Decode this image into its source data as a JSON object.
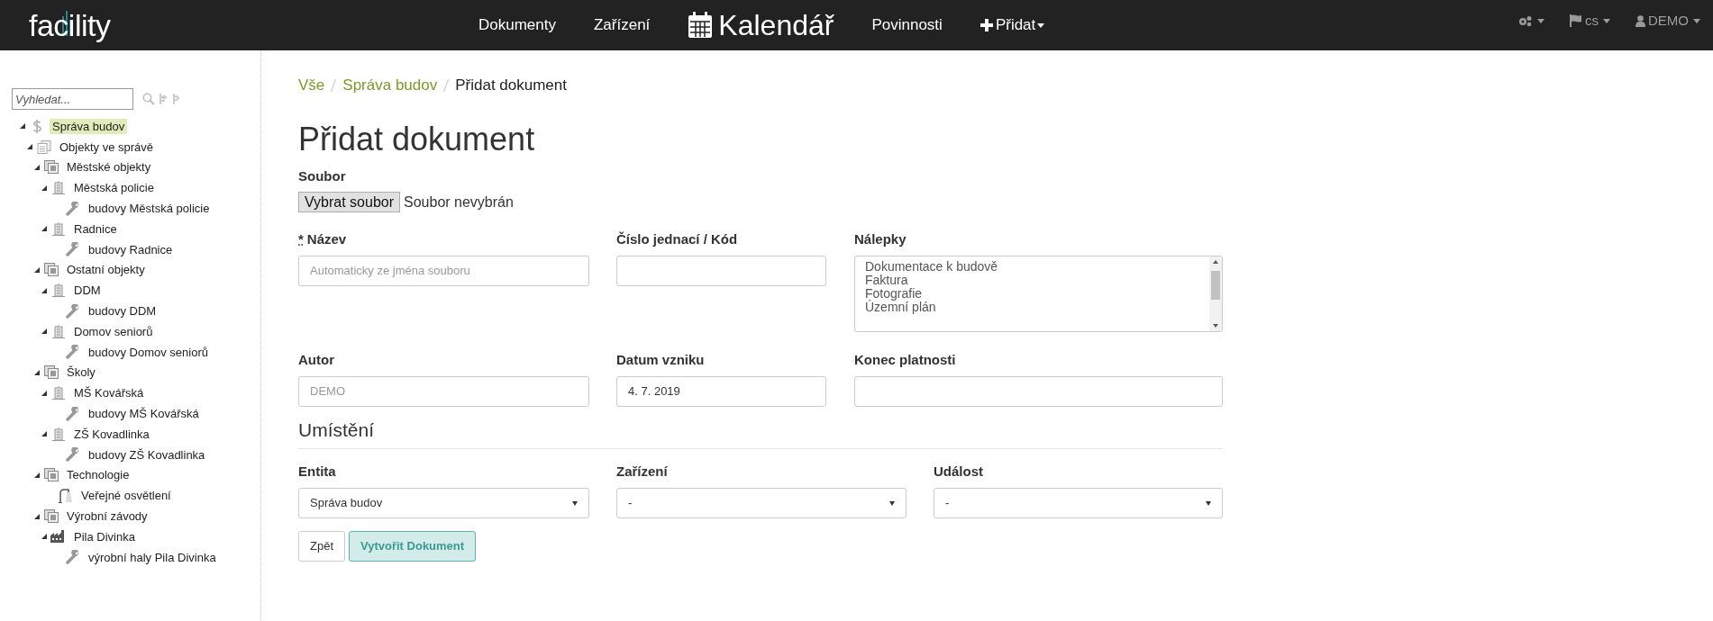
{
  "navbar": {
    "logo": "facility",
    "items": [
      {
        "label": "Dokumenty",
        "kind": "plain",
        "dropdown": false,
        "selected": false
      },
      {
        "label": "Zařízení",
        "kind": "plain",
        "dropdown": false,
        "selected": false
      },
      {
        "label": "Kalendář",
        "kind": "calendar",
        "dropdown": false,
        "selected": true
      },
      {
        "label": "Povinnosti",
        "kind": "plain",
        "dropdown": false,
        "selected": false
      },
      {
        "label": "Přidat",
        "kind": "add",
        "dropdown": true,
        "selected": false
      }
    ],
    "right": [
      {
        "kind": "settings"
      },
      {
        "label": "cs",
        "kind": "language"
      },
      {
        "label": "DEMO",
        "kind": "user"
      }
    ]
  },
  "sidebar": {
    "search": {
      "placeholder": "Vyhledat..."
    },
    "tree": [
      {
        "label": "Správa budov",
        "kind": "dollar",
        "expanded": true,
        "selected": true,
        "children": [
          {
            "label": "Objekty ve správě",
            "kind": "documents",
            "expanded": true,
            "selected": false,
            "children": [
              {
                "label": "Městské objekty",
                "kind": "group",
                "expanded": true,
                "selected": false,
                "children": [
                  {
                    "label": "Městská policie",
                    "kind": "building",
                    "expanded": true,
                    "selected": false,
                    "children": [
                      {
                        "label": "budovy Městská policie",
                        "kind": "wrench",
                        "selected": false
                      }
                    ]
                  },
                  {
                    "label": "Radnice",
                    "kind": "building",
                    "expanded": true,
                    "selected": false,
                    "children": [
                      {
                        "label": "budovy Radnice",
                        "kind": "wrench",
                        "selected": false
                      }
                    ]
                  }
                ]
              },
              {
                "label": "Ostatní objekty",
                "kind": "group",
                "expanded": true,
                "selected": false,
                "children": [
                  {
                    "label": "DDM",
                    "kind": "building",
                    "expanded": true,
                    "selected": false,
                    "children": [
                      {
                        "label": "budovy DDM",
                        "kind": "wrench",
                        "selected": false
                      }
                    ]
                  },
                  {
                    "label": "Domov seniorů",
                    "kind": "building",
                    "expanded": true,
                    "selected": false,
                    "children": [
                      {
                        "label": "budovy Domov seniorů",
                        "kind": "wrench",
                        "selected": false
                      }
                    ]
                  }
                ]
              },
              {
                "label": "Školy",
                "kind": "group",
                "expanded": true,
                "selected": false,
                "children": [
                  {
                    "label": "MŠ Kovářská",
                    "kind": "building",
                    "expanded": true,
                    "selected": false,
                    "children": [
                      {
                        "label": "budovy MŠ Kovářská",
                        "kind": "wrench",
                        "selected": false
                      }
                    ]
                  },
                  {
                    "label": "ZŠ Kovadlinka",
                    "kind": "building",
                    "expanded": true,
                    "selected": false,
                    "children": [
                      {
                        "label": "budovy ZŠ Kovadlinka",
                        "kind": "wrench",
                        "selected": false
                      }
                    ]
                  }
                ]
              },
              {
                "label": "Technologie",
                "kind": "group",
                "expanded": true,
                "selected": false,
                "children": [
                  {
                    "label": "Veřejné osvětlení",
                    "kind": "lamp",
                    "selected": false
                  }
                ]
              },
              {
                "label": "Výrobní závody",
                "kind": "group",
                "expanded": true,
                "selected": false,
                "children": [
                  {
                    "label": "Pila Divinka",
                    "kind": "factory",
                    "expanded": true,
                    "selected": false,
                    "children": [
                      {
                        "label": "výrobní haly Pila Divinka",
                        "kind": "wrench",
                        "selected": false
                      }
                    ]
                  }
                ]
              }
            ]
          }
        ]
      }
    ]
  },
  "breadcrumb": [
    "Vše",
    "Správa budov",
    "Přidat dokument"
  ],
  "title": "Přidat dokument",
  "file": {
    "label": "Soubor",
    "button": "Vybrat soubor",
    "status": "Soubor nevybrán"
  },
  "row1": [
    {
      "label": "Název",
      "required_mark": "*",
      "kind": "text",
      "placeholder": "Automaticky ze jména souboru"
    },
    {
      "label": "Číslo jednací / Kód",
      "kind": "text"
    },
    {
      "label": "Nálepky",
      "kind": "listbox",
      "options": [
        "Dokumentace k budově",
        "Faktura",
        "Fotografie",
        "Územní plán"
      ]
    }
  ],
  "row2": [
    {
      "label": "Autor",
      "kind": "text",
      "placeholder": "DEMO"
    },
    {
      "label": "Datum vzniku",
      "kind": "text",
      "value": "4. 7. 2019"
    },
    {
      "label": "Konec platnosti",
      "kind": "text"
    }
  ],
  "section": "Umístění",
  "row3": [
    {
      "label": "Entita",
      "value": "Správa budov"
    },
    {
      "label": "Zařízení",
      "value": "-"
    },
    {
      "label": "Událost",
      "value": "-"
    }
  ],
  "buttons": [
    {
      "label": "Zpět",
      "kind": "default"
    },
    {
      "label": "Vytvořit Dokument",
      "kind": "primary"
    }
  ]
}
